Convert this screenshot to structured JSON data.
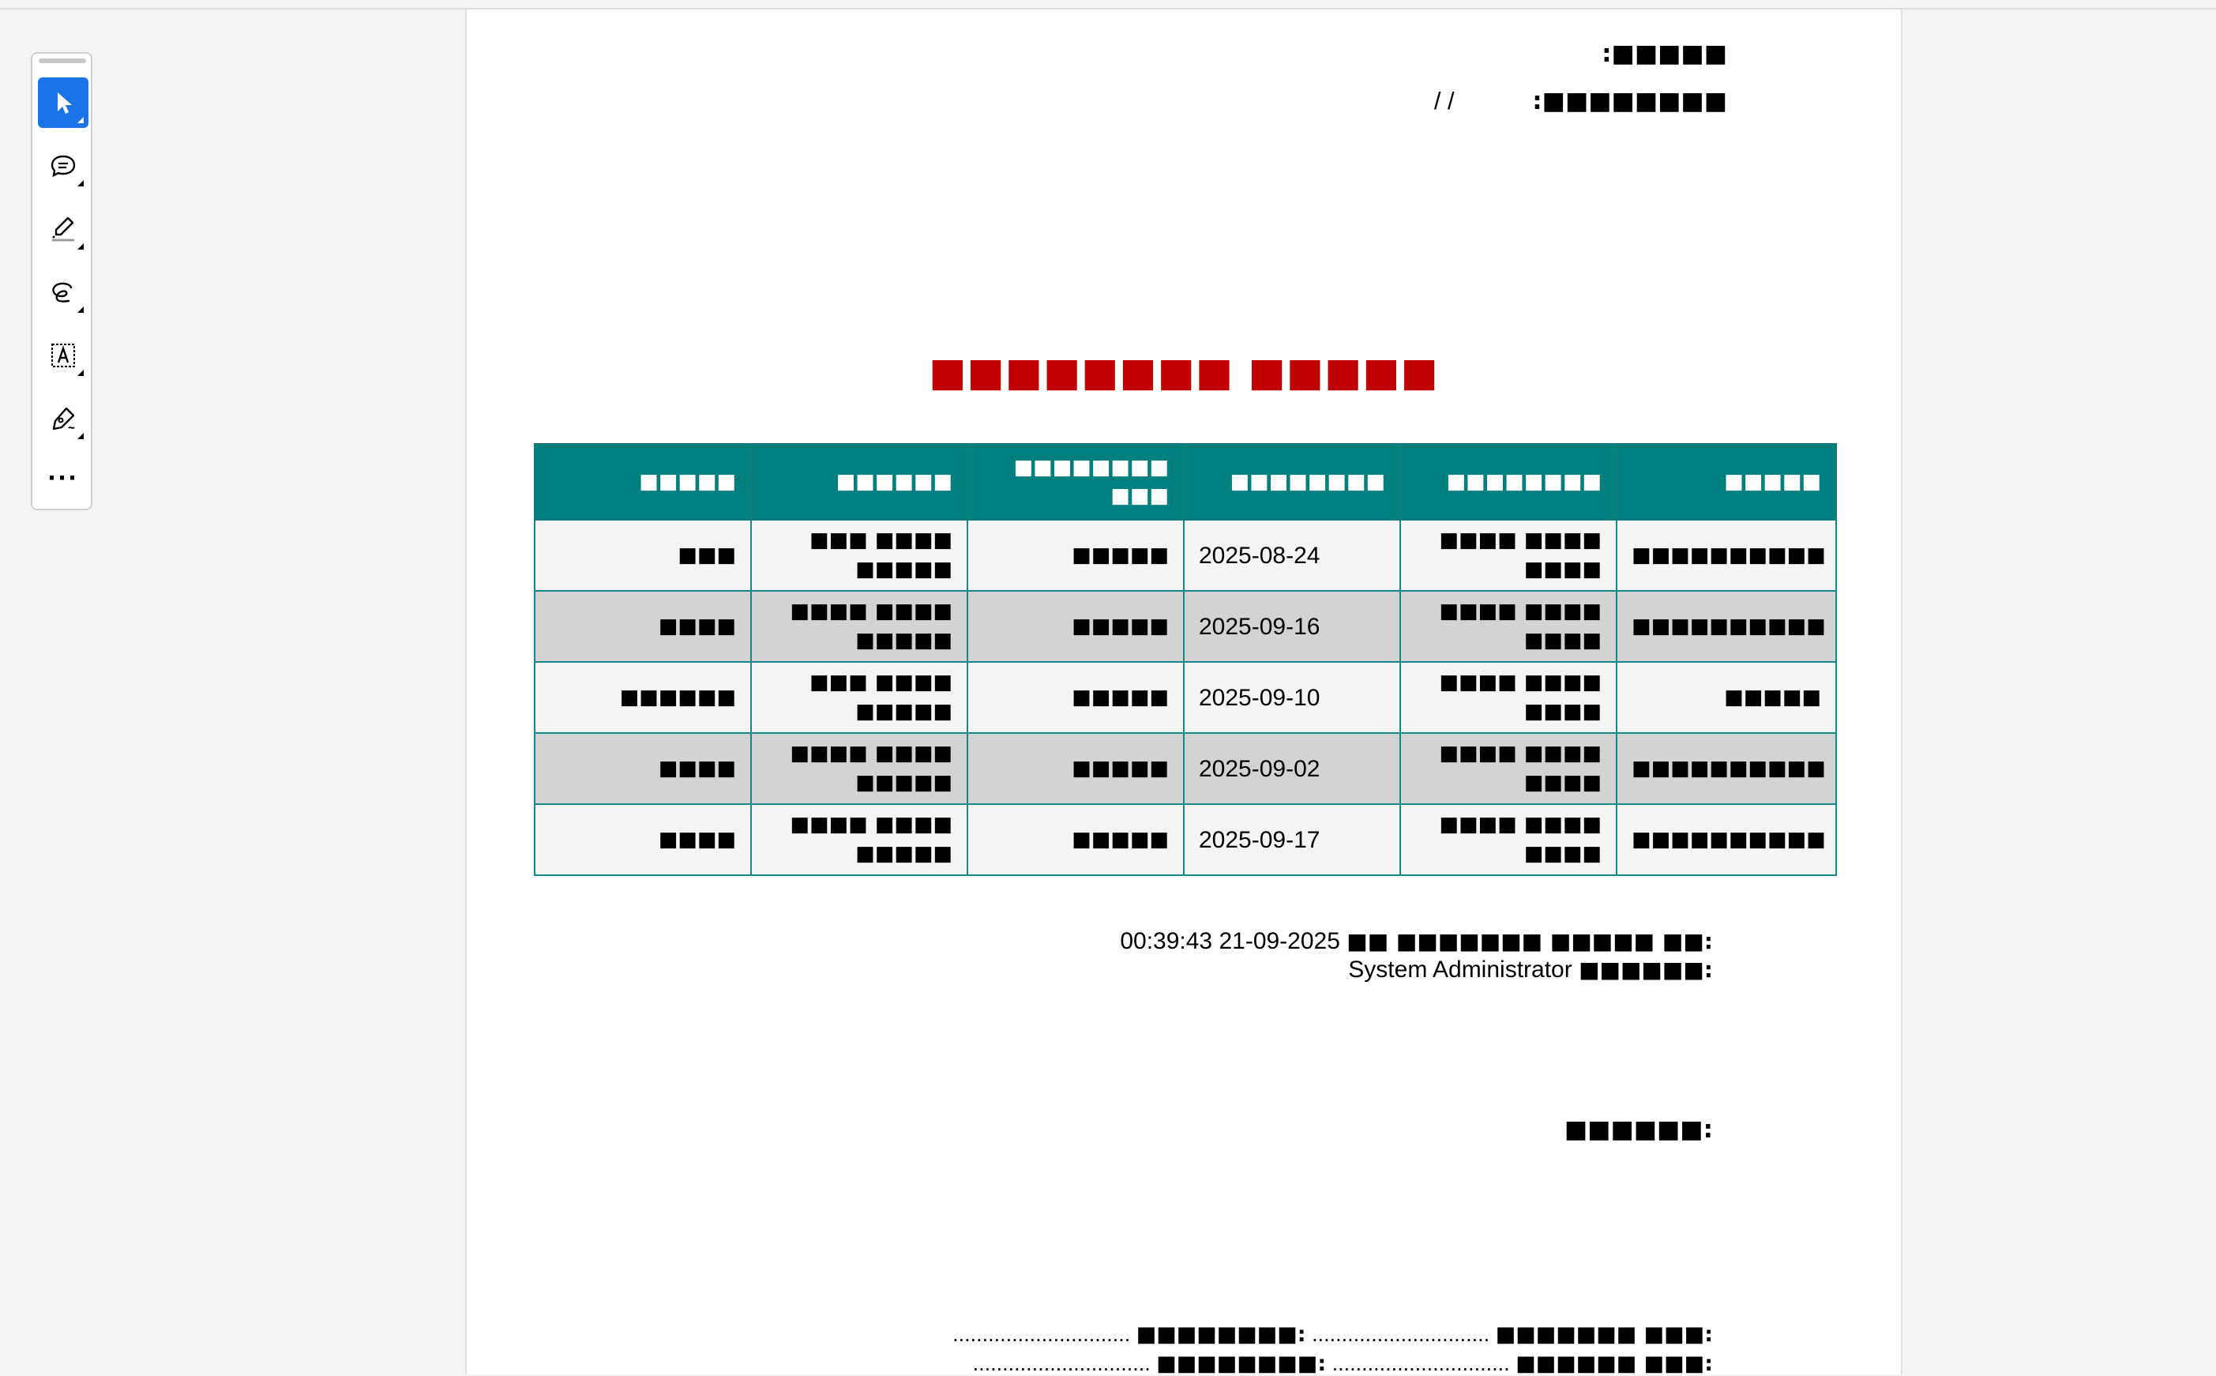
{
  "toolbar": {
    "tools": [
      {
        "name": "select-tool",
        "icon": "cursor-arrow-icon",
        "active": true
      },
      {
        "name": "comment-tool",
        "icon": "comment-bubble-icon",
        "active": false
      },
      {
        "name": "highlight-tool",
        "icon": "highlighter-icon",
        "active": false
      },
      {
        "name": "draw-tool",
        "icon": "freehand-lasso-icon",
        "active": false
      },
      {
        "name": "text-tool",
        "icon": "text-box-icon",
        "active": false
      },
      {
        "name": "sign-tool",
        "icon": "pen-sign-icon",
        "active": false
      }
    ],
    "more_label": "···",
    "accent_color": "#1a73e8"
  },
  "document": {
    "header": {
      "line1": "■■■■■:",
      "line2_label": "■■■■■■■■:",
      "line2_value": "/ /"
    },
    "title": "■■■■■■■■ ■■■■■",
    "title_color": "#c00000",
    "table": {
      "header_color": "#007f7f",
      "columns": [
        "■■■■■",
        "■■■■■■",
        "■■■■■■■■ ■■■",
        "■■■■■■■■",
        "■■■■■■■■",
        "■■■■■"
      ],
      "rows": [
        [
          "■■■",
          "■■■ ■■■■ ■■■■■",
          "■■■■■",
          "2025-08-24",
          "■■■■ ■■■■ ■■■■",
          "■■■■■■■■■■"
        ],
        [
          "■■■■",
          "■■■■ ■■■■ ■■■■■",
          "■■■■■",
          "2025-09-16",
          "■■■■ ■■■■ ■■■■",
          "■■■■■■■■■■"
        ],
        [
          "■■■■■■",
          "■■■ ■■■■ ■■■■■",
          "■■■■■",
          "2025-09-10",
          "■■■■ ■■■■ ■■■■",
          "■■■■■"
        ],
        [
          "■■■■",
          "■■■■ ■■■■ ■■■■■",
          "■■■■■",
          "2025-09-02",
          "■■■■ ■■■■ ■■■■",
          "■■■■■■■■■■"
        ],
        [
          "■■■■",
          "■■■■ ■■■■ ■■■■■",
          "■■■■■",
          "2025-09-17",
          "■■■■ ■■■■ ■■■■",
          "■■■■■■■■■■"
        ]
      ]
    },
    "printed_label": "■■ ■■■■■■■ ■■■■■ ■■:",
    "printed_value": "00:39:43 21-09-2025",
    "user_label": "■■■■■■:",
    "user_value": "System Administrator",
    "signature_label": "■■■■■■:",
    "footer": {
      "row1": {
        "label_a": "■■■■■■■ ■■■:",
        "dots_a": "..............................",
        "label_b": "■■■■■■■■:",
        "dots_b": ".............................."
      },
      "row2": {
        "label_a": "■■■■■■ ■■■:",
        "dots_a": "..............................",
        "label_b": "■■■■■■■■:",
        "dots_b": ".............................."
      }
    }
  }
}
